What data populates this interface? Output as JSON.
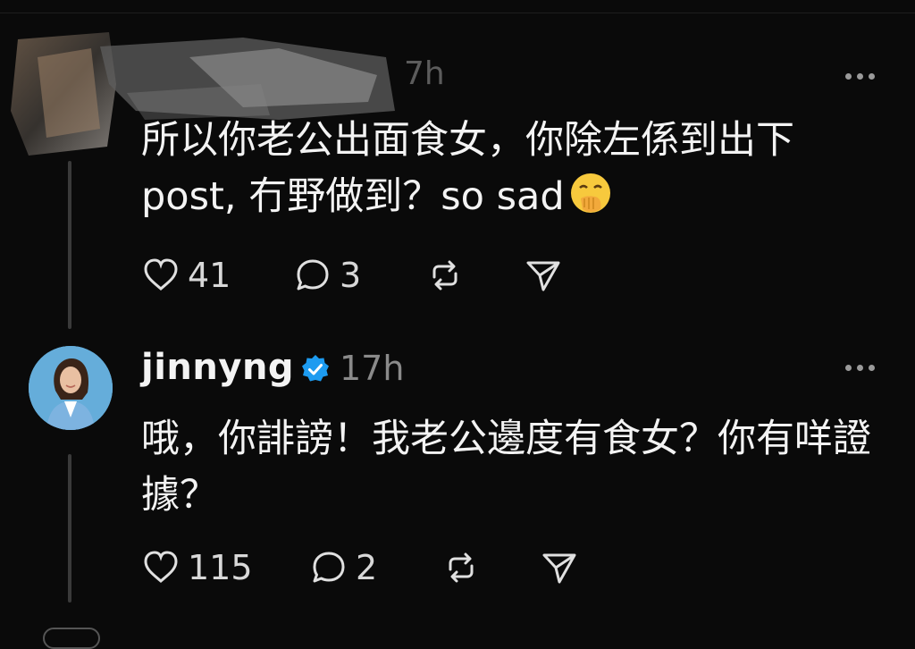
{
  "reply1": {
    "time_partial": "7h",
    "text": "所以你老公出面食女，你除左係到出下 post, 冇野做到？so sad",
    "emoji_icon": "hand-over-mouth-emoji",
    "likes": "41",
    "replies": "3"
  },
  "reply2": {
    "username": "jinnyng",
    "verified_icon": "verified-badge-icon",
    "time": "17h",
    "text": "哦，你誹謗！我老公邊度有食女？你有咩證據？",
    "likes": "115",
    "replies": "2"
  },
  "colors": {
    "background": "#0a0a0a",
    "text": "#f3f3f3",
    "muted": "#8a8a8a",
    "verified": "#1d9bf0"
  }
}
